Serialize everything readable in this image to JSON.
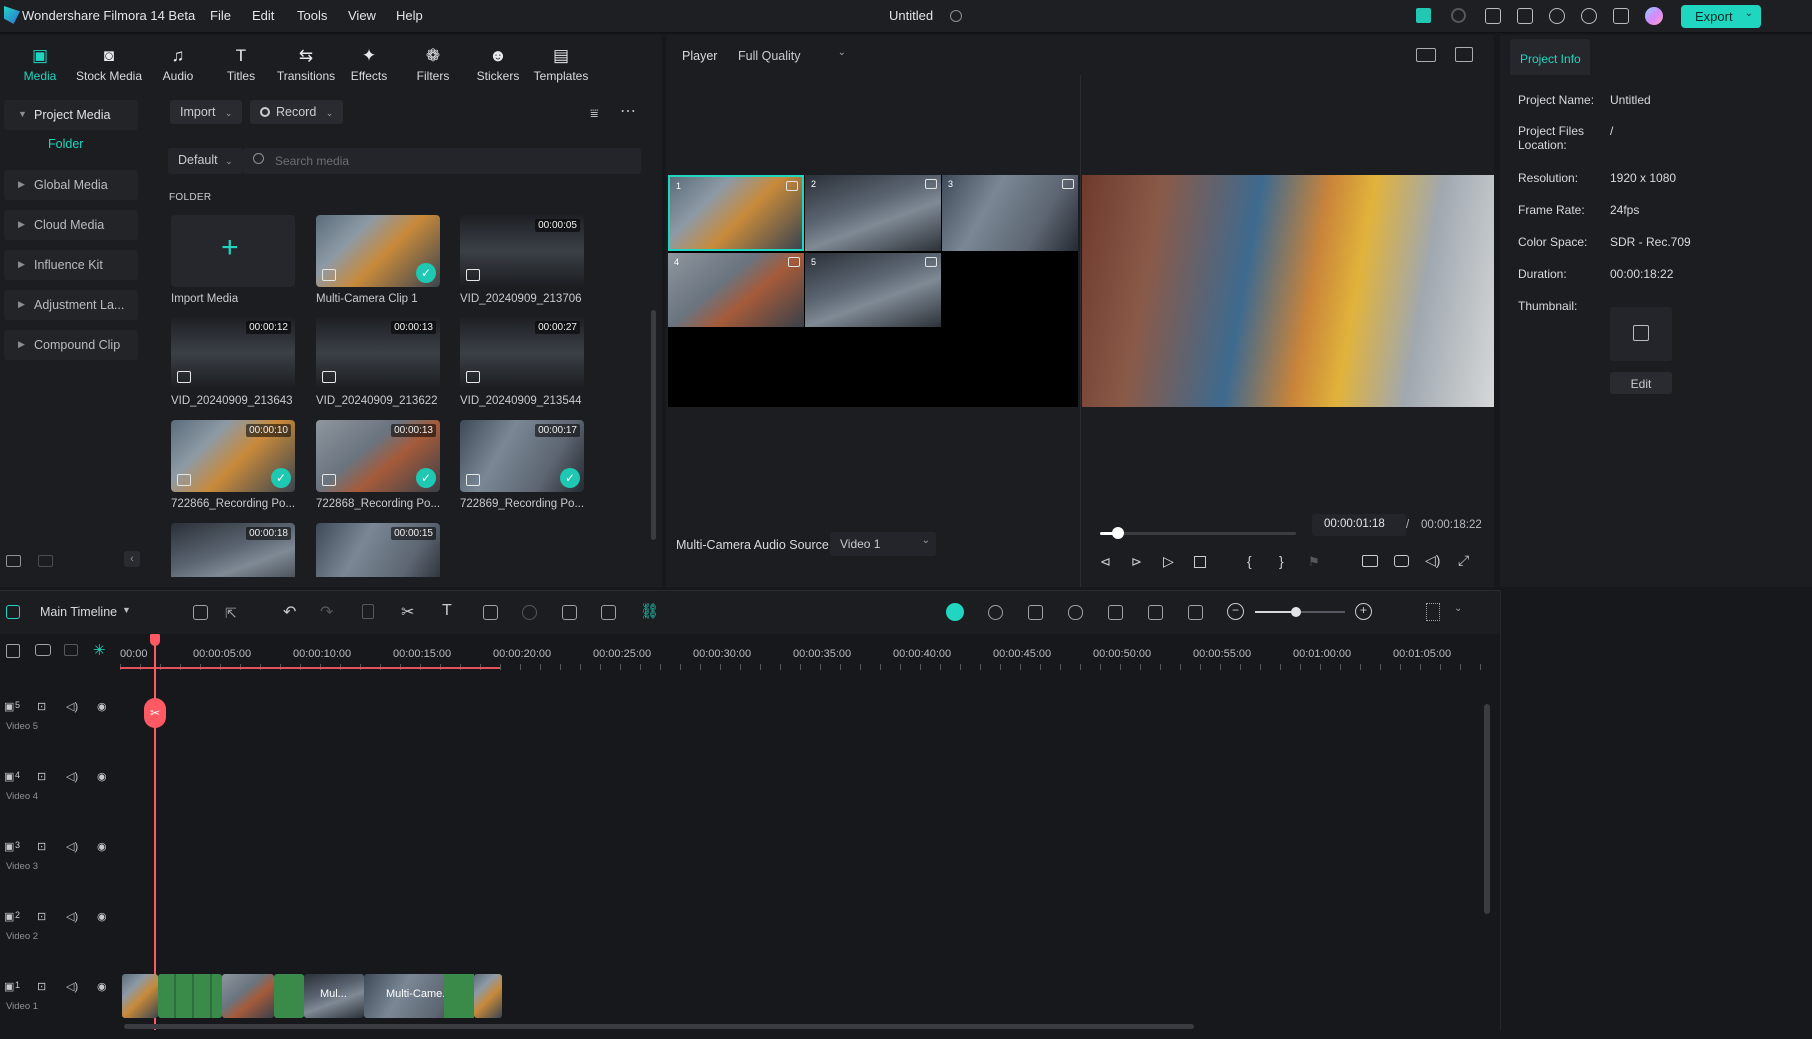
{
  "app": {
    "title": "Wondershare Filmora 14 Beta",
    "project_title": "Untitled",
    "export_label": "Export"
  },
  "menu": [
    "File",
    "Edit",
    "Tools",
    "View",
    "Help"
  ],
  "media_tabs": [
    {
      "label": "Media",
      "icon": "media-icon"
    },
    {
      "label": "Stock Media",
      "icon": "stock-media-icon"
    },
    {
      "label": "Audio",
      "icon": "audio-icon"
    },
    {
      "label": "Titles",
      "icon": "titles-icon"
    },
    {
      "label": "Transitions",
      "icon": "transitions-icon"
    },
    {
      "label": "Effects",
      "icon": "effects-icon"
    },
    {
      "label": "Filters",
      "icon": "filters-icon"
    },
    {
      "label": "Stickers",
      "icon": "stickers-icon"
    },
    {
      "label": "Templates",
      "icon": "templates-icon"
    }
  ],
  "sidebar": {
    "items": [
      "Project Media",
      "Global Media",
      "Cloud Media",
      "Influence Kit",
      "Adjustment La...",
      "Compound Clip"
    ],
    "folder_label": "Folder"
  },
  "media_toolbar": {
    "import_label": "Import",
    "record_label": "Record",
    "sort_label": "Default",
    "search_placeholder": "Search media",
    "folder_header": "FOLDER"
  },
  "media_items": [
    {
      "label": "Import Media",
      "duration": ""
    },
    {
      "label": "Multi-Camera Clip 1",
      "duration": ""
    },
    {
      "label": "VID_20240909_213706",
      "duration": "00:00:05"
    },
    {
      "label": "VID_20240909_213643",
      "duration": "00:00:12"
    },
    {
      "label": "VID_20240909_213622",
      "duration": "00:00:13"
    },
    {
      "label": "VID_20240909_213544",
      "duration": "00:00:27"
    },
    {
      "label": "722866_Recording Po...",
      "duration": "00:00:10"
    },
    {
      "label": "722868_Recording Po...",
      "duration": "00:00:13"
    },
    {
      "label": "722869_Recording Po...",
      "duration": "00:00:17"
    },
    {
      "label": "",
      "duration": "00:00:18"
    },
    {
      "label": "",
      "duration": "00:00:15"
    }
  ],
  "player": {
    "label": "Player",
    "quality": "Full Quality",
    "cam_numbers": [
      "1",
      "2",
      "3",
      "4",
      "5"
    ],
    "audio_source_label": "Multi-Camera Audio Source",
    "audio_source_value": "Video 1",
    "current_time": "00:00:01:18",
    "separator": "/",
    "total_time": "00:00:18:22",
    "progress": 0.09
  },
  "project_info": {
    "tab_label": "Project Info",
    "rows": [
      {
        "k": "Project Name:",
        "v": "Untitled"
      },
      {
        "k": "Project Files Location:",
        "v": "/"
      },
      {
        "k": "Resolution:",
        "v": "1920 x 1080"
      },
      {
        "k": "Frame Rate:",
        "v": "24fps"
      },
      {
        "k": "Color Space:",
        "v": "SDR - Rec.709"
      },
      {
        "k": "Duration:",
        "v": "00:00:18:22"
      },
      {
        "k": "Thumbnail:",
        "v": ""
      }
    ],
    "edit_label": "Edit"
  },
  "timeline": {
    "name": "Main Timeline",
    "ruler": [
      "00:00",
      "00:00:05:00",
      "00:00:10:00",
      "00:00:15:00",
      "00:00:20:00",
      "00:00:25:00",
      "00:00:30:00",
      "00:00:35:00",
      "00:00:40:00",
      "00:00:45:00",
      "00:00:50:00",
      "00:00:55:00",
      "00:01:00:00",
      "00:01:05:00"
    ],
    "tracks": [
      {
        "num": "5",
        "label": "Video 5"
      },
      {
        "num": "4",
        "label": "Video 4"
      },
      {
        "num": "3",
        "label": "Video 3"
      },
      {
        "num": "2",
        "label": "Video 2"
      },
      {
        "num": "1",
        "label": "Video 1"
      }
    ],
    "clip_labels": [
      "Mul...",
      "Multi-Came..."
    ]
  }
}
